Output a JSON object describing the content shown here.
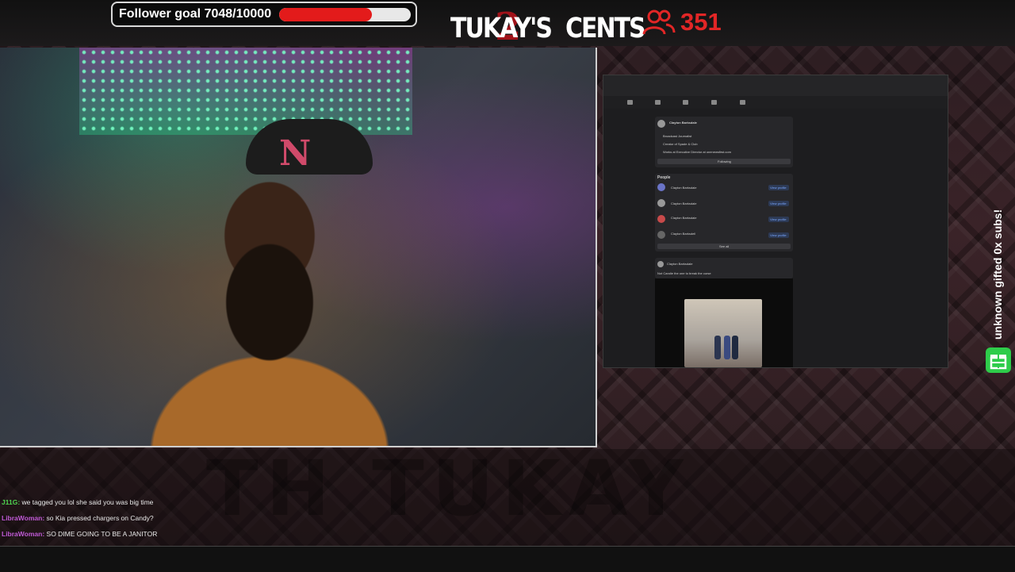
{
  "overlay": {
    "follower_goal": {
      "label": "Follower goal 7048/10000",
      "current": 7048,
      "target": 10000,
      "progress_percent": 70.48,
      "bar_color": "#e31b1b"
    },
    "logo": {
      "text": "TUKAY'S",
      "text2": "CENTS",
      "numeral": "2"
    },
    "viewers": {
      "icon": "users-icon",
      "count": "351",
      "color": "#e22626"
    },
    "side_alert": {
      "text": "unknown gifted 0x subs!",
      "icon": "gift-icon"
    }
  },
  "shared_screen": {
    "profile": {
      "name": "Clayton Barksdale",
      "details": [
        "Broadcast Journalist",
        "Creator of Spade & Club",
        "Works at Executive Director at onenewsfirst.com"
      ],
      "button": "Following"
    },
    "people": {
      "heading": "People",
      "items": [
        {
          "name": "Clayton Barksdale",
          "action": "View profile"
        },
        {
          "name": "Clayton Barksdale",
          "action": "View profile"
        },
        {
          "name": "Clayton Barksdale",
          "action": "View profile"
        },
        {
          "name": "Clayton Barksdell",
          "action": "View profile"
        }
      ],
      "see_all": "See all"
    },
    "post": {
      "author": "Clayton Barksdale",
      "text": "Not Candie the one to break the curse"
    }
  },
  "chat": {
    "messages": [
      {
        "user": "J11G:",
        "text": "we tagged you lol she said you was big time",
        "color": "#4fd14f"
      },
      {
        "user": "LibraWoman:",
        "text": "so Kia pressed chargers on Candy?",
        "color": "#c05ad6"
      },
      {
        "user": "LibraWoman:",
        "text": "SO DIME GOING TO BE A JANITOR",
        "color": "#c05ad6"
      }
    ]
  },
  "watermark": "TH TUKAY"
}
